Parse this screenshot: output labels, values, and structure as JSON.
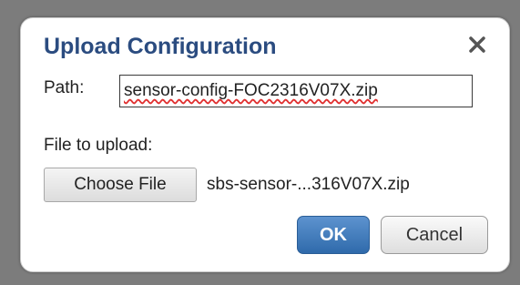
{
  "dialog": {
    "title": "Upload Configuration",
    "close_icon": "close-icon",
    "path_label": "Path:",
    "path_value": "sensor-config-FOC2316V07X.zip",
    "file_label": "File to upload:",
    "choose_file_label": "Choose File",
    "selected_file": "sbs-sensor-...316V07X.zip",
    "ok_label": "OK",
    "cancel_label": "Cancel"
  },
  "colors": {
    "title": "#2b4c80",
    "ok_button": "#3b76b8",
    "backdrop": "#7c7c7c"
  }
}
